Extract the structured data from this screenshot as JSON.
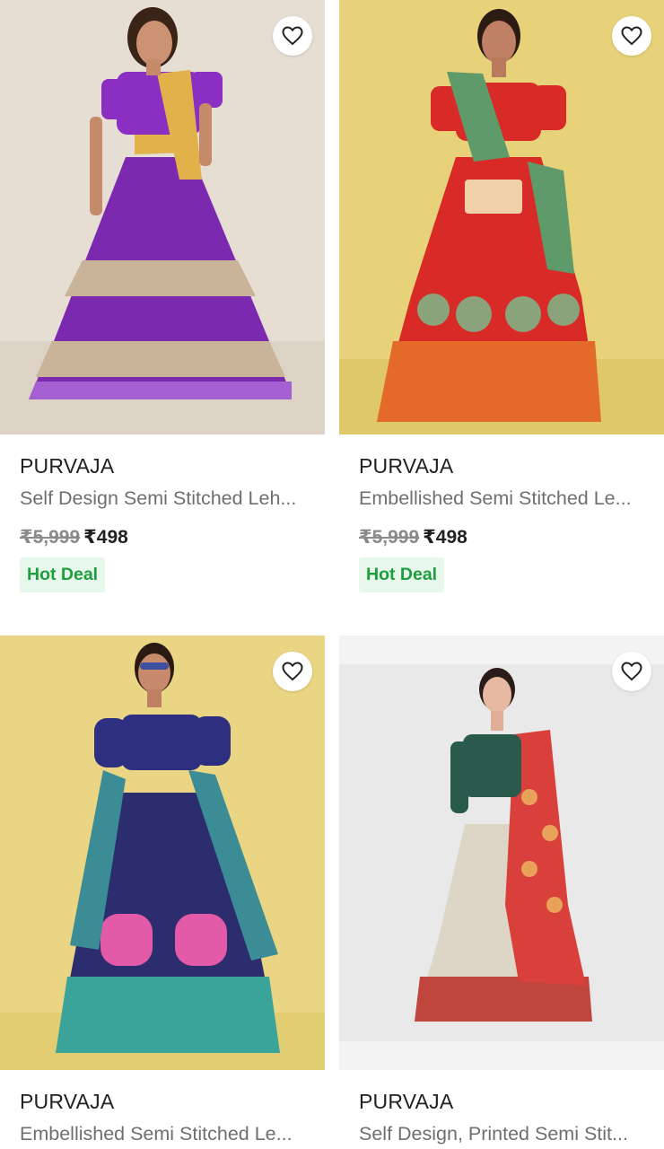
{
  "products": [
    {
      "brand": "PURVAJA",
      "title": "Self Design Semi Stitched Leh...",
      "mrp": "₹5,999",
      "price": "₹498",
      "badge": "Hot Deal",
      "image": "purple lehenga photo"
    },
    {
      "brand": "PURVAJA",
      "title": "Embellished Semi Stitched Le...",
      "mrp": "₹5,999",
      "price": "₹498",
      "badge": "Hot Deal",
      "image": "red lehenga photo"
    },
    {
      "brand": "PURVAJA",
      "title": "Embellished Semi Stitched Le...",
      "image": "navy and teal lehenga photo"
    },
    {
      "brand": "PURVAJA",
      "title": "Self Design, Printed Semi Stit...",
      "image": "green and red lehenga photo"
    }
  ],
  "icons": {
    "wishlist": "heart-outline-icon"
  },
  "colors": {
    "deal_text": "#1e9e3e",
    "deal_bg": "#e8f7ec",
    "brand": "#212121",
    "title": "#6f6f6f"
  }
}
